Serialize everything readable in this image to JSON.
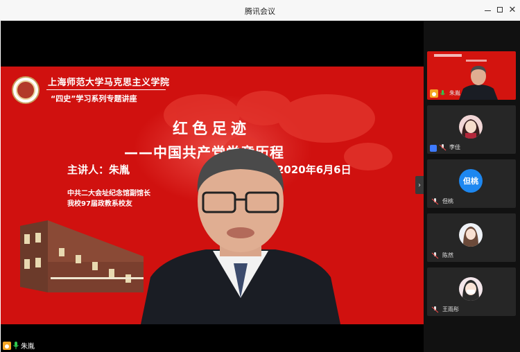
{
  "window": {
    "title": "腾讯会议",
    "minimize": "—",
    "close": "✕"
  },
  "slide": {
    "school": "上海师范大学马克思主义学院",
    "series": "“四史”学习系列专题讲座",
    "title_line1": "红色足迹",
    "title_line2": "——中国共产党党章历程",
    "speaker": "主讲人：朱胤",
    "date": "2020年6月6日",
    "sub1": "中共二大会址纪念馆副馆长",
    "sub2": "我校97届政教系校友"
  },
  "main_user": {
    "name": "朱胤"
  },
  "collapse_glyph": "›",
  "participants": [
    {
      "name": "朱胤",
      "type": "slide"
    },
    {
      "name": "李佳",
      "type": "avatar"
    },
    {
      "name": "但桃",
      "type": "text",
      "avatar_text": "但桃"
    },
    {
      "name": "陈然",
      "type": "avatar"
    },
    {
      "name": "王雨彤",
      "type": "avatar"
    }
  ],
  "colors": {
    "slide_red": "#d0110f",
    "accent_blue": "#1d87f0",
    "mic_green": "#2ec74e",
    "user_orange": "#f5a623"
  }
}
